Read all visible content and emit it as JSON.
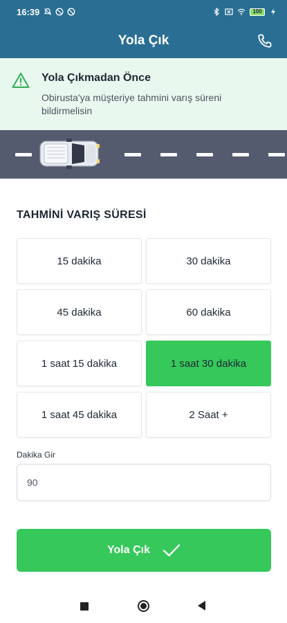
{
  "status_bar": {
    "time": "16:39",
    "battery_level": "100",
    "left_icons": [
      "mute-bell-icon",
      "no-signal-icon",
      "no-signal-icon"
    ],
    "right_icons": [
      "bluetooth-icon",
      "x-box-icon",
      "wifi-icon",
      "battery-icon",
      "charging-icon"
    ]
  },
  "app_bar": {
    "title": "Yola Çık",
    "action_icon": "phone-icon"
  },
  "alert": {
    "icon": "warning-triangle-icon",
    "heading": "Yola Çıkmadan Önce",
    "message": "Obirusta'ya müşteriye tahmini varış süreni bildirmelisin"
  },
  "road_banner": {
    "icon": "car-icon"
  },
  "eta": {
    "section_title": "TAHMİNİ VARIŞ SÜRESİ",
    "options": [
      {
        "label": "15 dakika",
        "selected": false
      },
      {
        "label": "30 dakika",
        "selected": false
      },
      {
        "label": "45 dakika",
        "selected": false
      },
      {
        "label": "60 dakika",
        "selected": false
      },
      {
        "label": "1 saat 15 dakika",
        "selected": false
      },
      {
        "label": "1 saat 30 dakika",
        "selected": true
      },
      {
        "label": "1 saat 45 dakika",
        "selected": false
      },
      {
        "label": "2 Saat +",
        "selected": false
      }
    ]
  },
  "minutes_input": {
    "label": "Dakika Gir",
    "value": "90"
  },
  "submit": {
    "label": "Yola Çık",
    "icon": "checkmark-icon"
  },
  "colors": {
    "primary": "#2a6e93",
    "accent_green": "#36c85a",
    "alert_bg": "#e9f8ef",
    "road": "#545b6e"
  }
}
